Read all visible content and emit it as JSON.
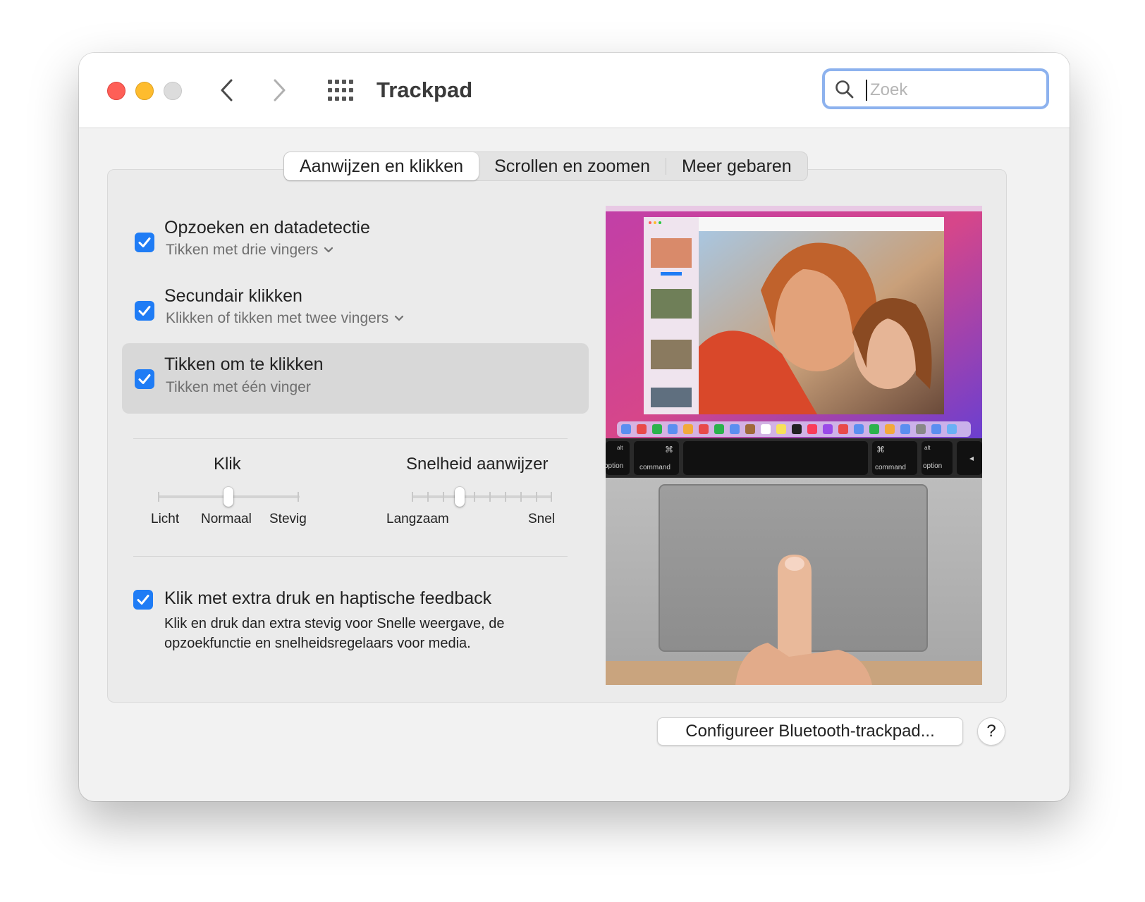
{
  "window": {
    "title": "Trackpad",
    "search_placeholder": "Zoek"
  },
  "tabs": [
    {
      "label": "Aanwijzen en klikken",
      "active": true
    },
    {
      "label": "Scrollen en zoomen",
      "active": false
    },
    {
      "label": "Meer gebaren",
      "active": false
    }
  ],
  "options": [
    {
      "title": "Opzoeken en datadetectie",
      "subtitle": "Tikken met drie vingers",
      "checked": true,
      "has_dropdown": true
    },
    {
      "title": "Secundair klikken",
      "subtitle": "Klikken of tikken met twee vingers",
      "checked": true,
      "has_dropdown": true
    },
    {
      "title": "Tikken om te klikken",
      "subtitle": "Tikken met één vinger",
      "checked": true,
      "has_dropdown": false
    }
  ],
  "sliders": {
    "click": {
      "title": "Klik",
      "labels": [
        "Licht",
        "Normaal",
        "Stevig"
      ],
      "value": "Normaal"
    },
    "speed": {
      "title": "Snelheid aanwijzer",
      "min_label": "Langzaam",
      "max_label": "Snel",
      "value_fraction": 0.32
    }
  },
  "force_click": {
    "title": "Klik met extra druk en haptische feedback",
    "description": "Klik en druk dan extra stevig voor Snelle weergave, de opzoekfunctie en snelheidsregelaars voor media.",
    "checked": true
  },
  "preview_keys": {
    "left_option": "option",
    "left_command": "command",
    "right_command": "command",
    "right_option": "option",
    "alt": "alt",
    "cmd_symbol": "⌘"
  },
  "buttons": {
    "bluetooth": "Configureer Bluetooth-trackpad...",
    "help": "?"
  },
  "colors": {
    "accent": "#1f7cf5",
    "close": "#fe5f57",
    "minimize": "#febc2e",
    "zoom_disabled": "#dcdcdc",
    "search_focus_ring": "#8db2ee"
  }
}
